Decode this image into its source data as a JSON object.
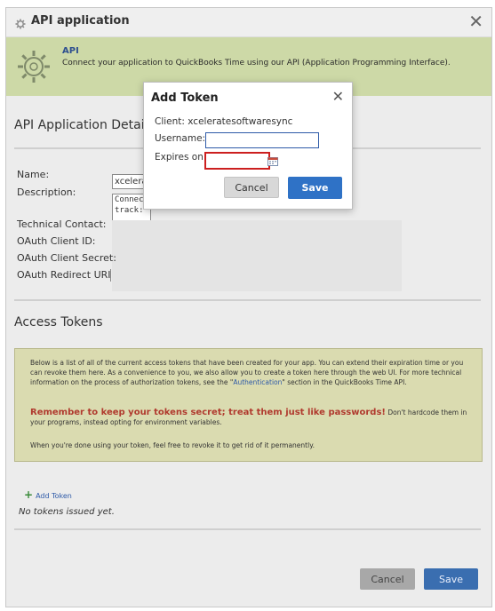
{
  "window": {
    "title": "API application"
  },
  "banner": {
    "heading": "API",
    "description": "Connect your application to QuickBooks Time using our API (Application Programming Interface)."
  },
  "details": {
    "section_title": "API Application Details",
    "name_label": "Name:",
    "name_value": "xcelera",
    "description_label": "Description:",
    "description_value_line1": "Connec",
    "description_value_line2": "track:",
    "technical_contact_label": "Technical Contact:",
    "oauth_client_id_label": "OAuth Client ID:",
    "oauth_client_secret_label": "OAuth Client Secret:",
    "oauth_redirect_uri_label": "OAuth Redirect URI"
  },
  "tokens": {
    "section_title": "Access Tokens",
    "info_text_before_link": "Below is a list of all of the current access tokens that have been created for your app. You can extend their expiration time or you can revoke them here. As a convenience to you, we also allow you to create a token here through the web UI. For more technical information on the process of authorization tokens, see the \"",
    "info_link": "Authentication",
    "info_text_after_link": "\" section in the QuickBooks Time API.",
    "warning_bold": "Remember to keep your tokens secret; treat them just like passwords!",
    "warning_rest": " Don't hardcode them in your programs, instead opting for environment variables.",
    "revoke_text": "When you're done using your token, feel free to revoke it to get rid of it permanently.",
    "add_token_label": "Add Token",
    "empty_text": "No tokens issued yet."
  },
  "footer": {
    "cancel_label": "Cancel",
    "save_label": "Save"
  },
  "modal": {
    "title": "Add Token",
    "client_label": "Client: xceleratesoftwaresync",
    "username_label": "Username:",
    "username_value": "",
    "expires_label": "Expires on",
    "expires_value": "",
    "cancel_label": "Cancel",
    "save_label": "Save"
  },
  "colors": {
    "banner_bg": "#cdd9a7",
    "info_bg": "#dadbb0",
    "primary_button": "#2f72c6",
    "warning_text": "#b03a2e",
    "error_border": "#cc1f1f"
  },
  "icons": [
    "gear-icon",
    "close-icon",
    "plus-icon",
    "calendar-icon"
  ]
}
